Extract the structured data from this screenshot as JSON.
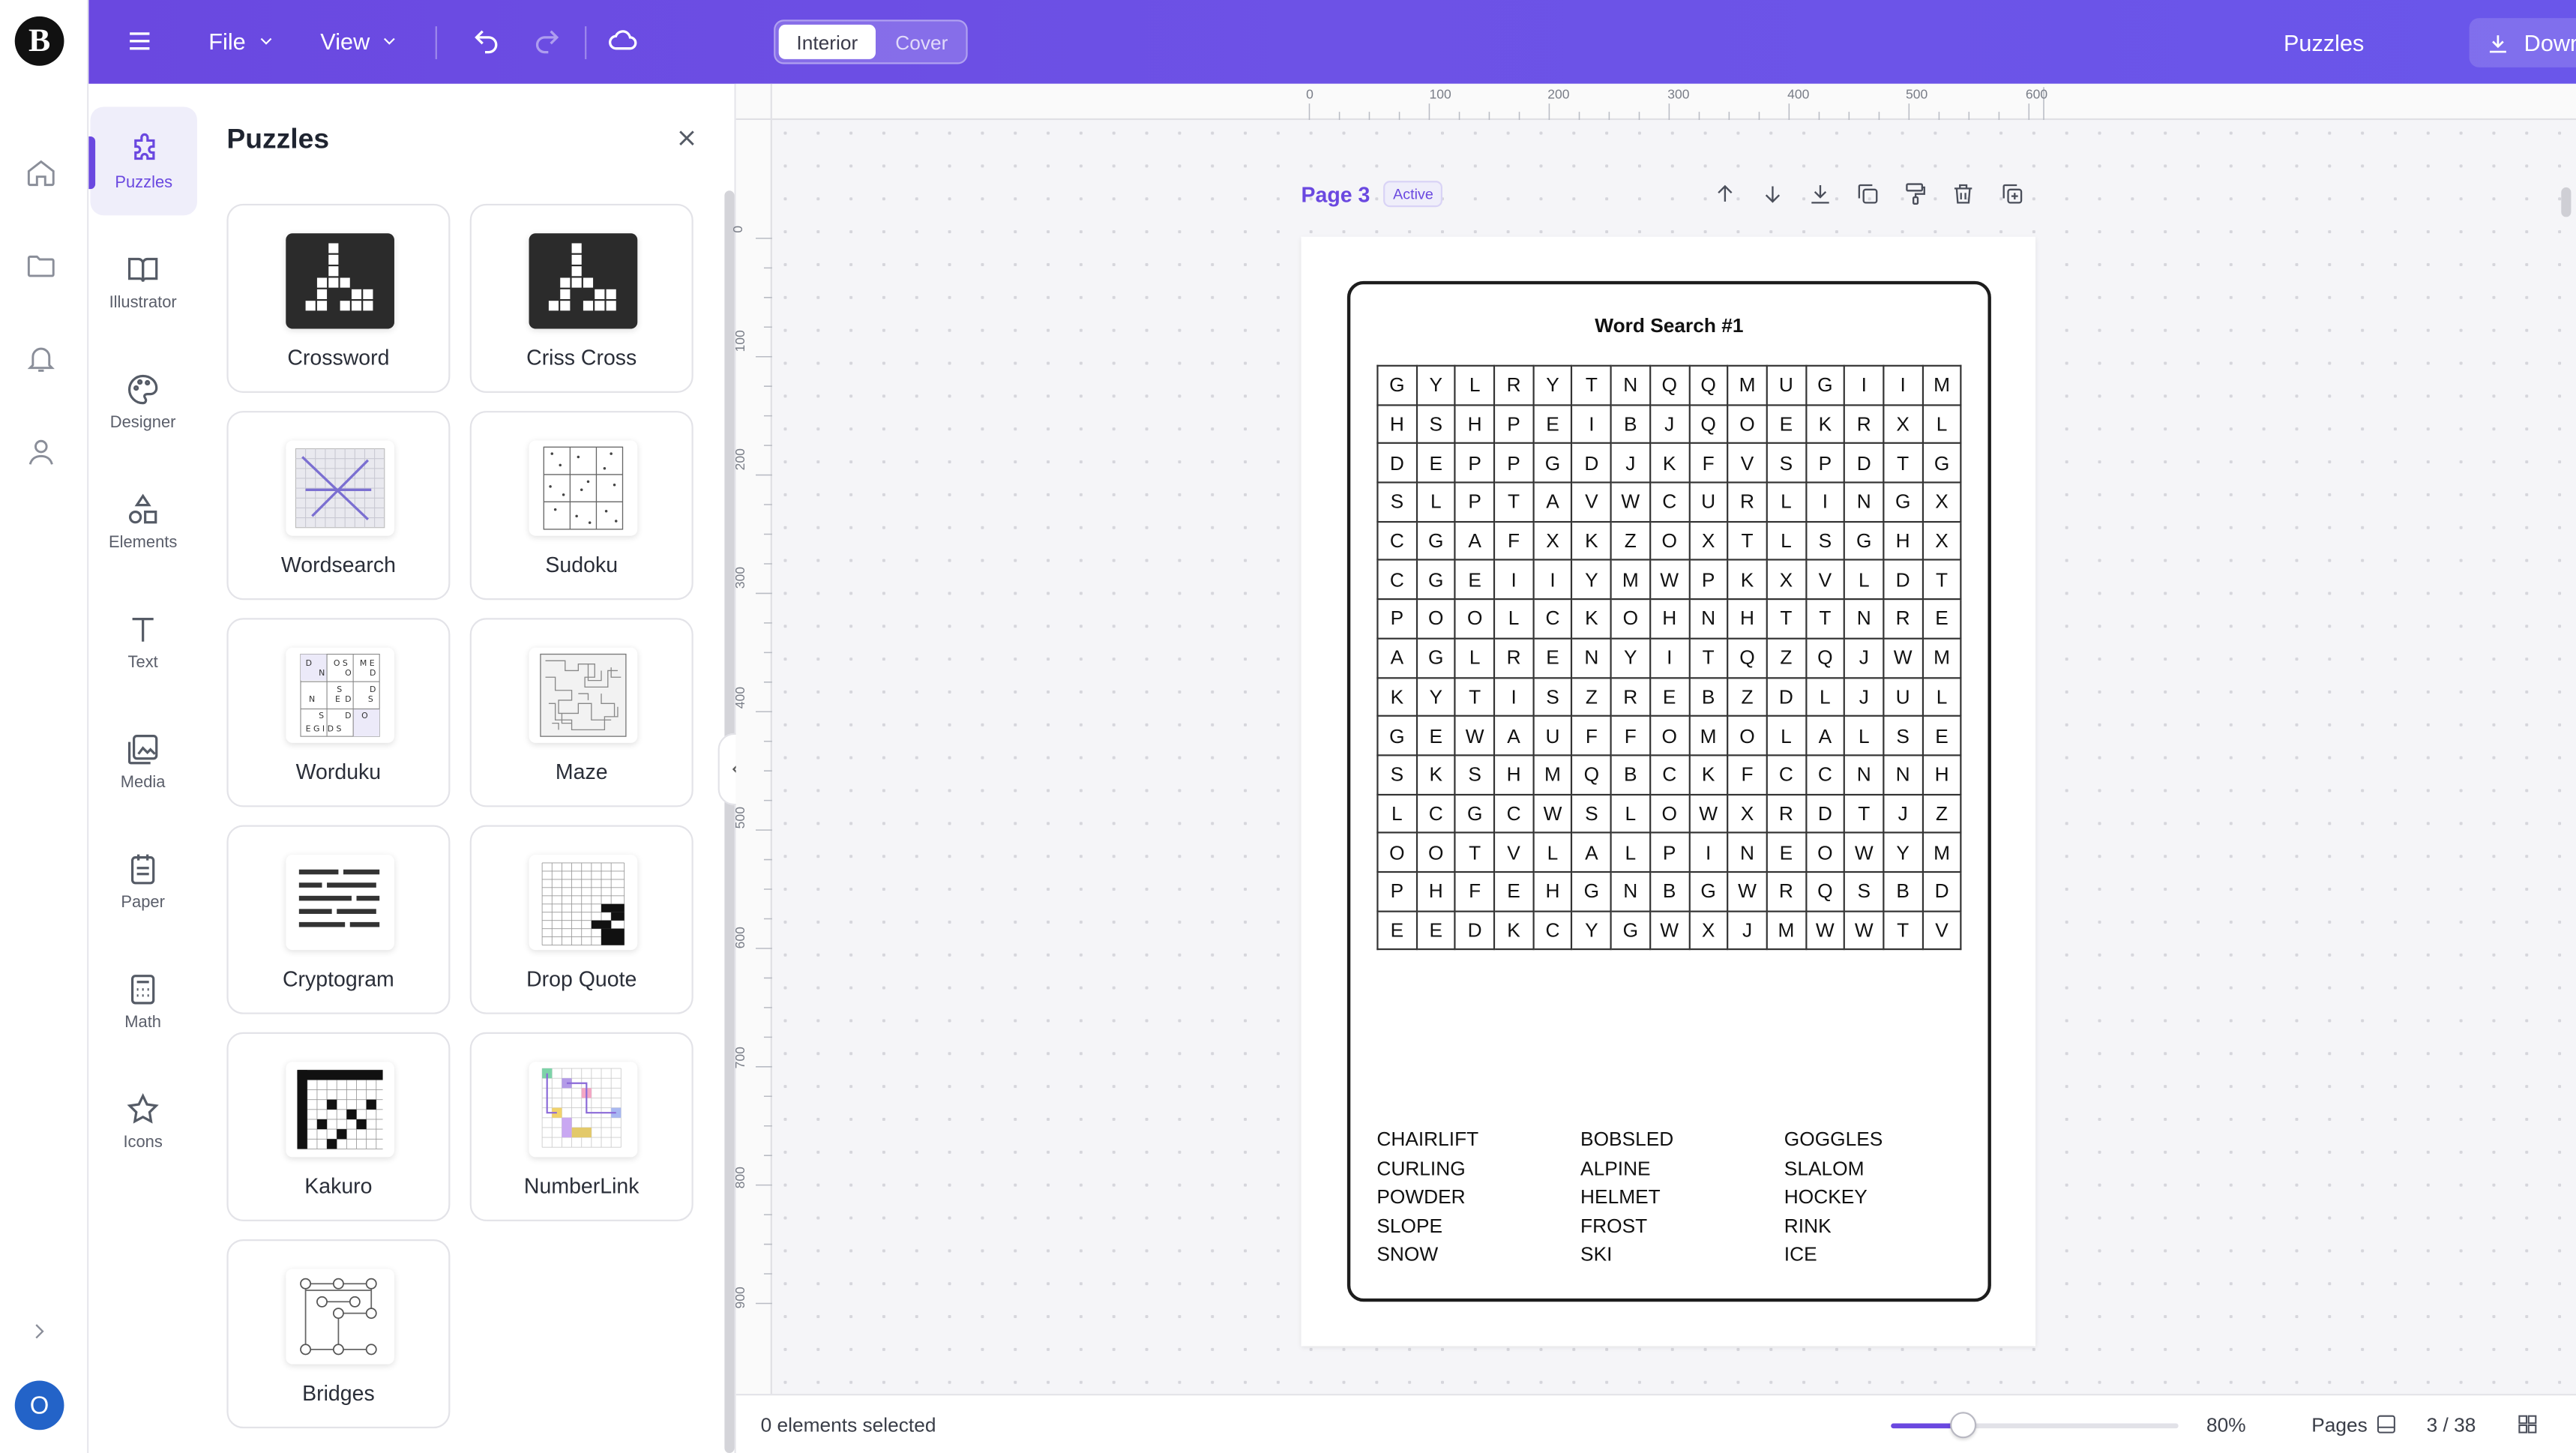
{
  "app": {
    "logo_letter": "B"
  },
  "topbar": {
    "menus": [
      {
        "label": "File"
      },
      {
        "label": "View"
      }
    ],
    "mode_tabs": [
      {
        "label": "Interior",
        "active": true
      },
      {
        "label": "Cover",
        "active": false
      }
    ],
    "puzzles_link": "Puzzles",
    "download_label": "Download"
  },
  "tools": [
    {
      "label": "Puzzles",
      "icon": "puzzle-icon",
      "active": true
    },
    {
      "label": "Illustrator",
      "icon": "book-icon"
    },
    {
      "label": "Designer",
      "icon": "palette-icon"
    },
    {
      "label": "Elements",
      "icon": "shapes-icon"
    },
    {
      "label": "Text",
      "icon": "text-icon"
    },
    {
      "label": "Media",
      "icon": "image-icon"
    },
    {
      "label": "Paper",
      "icon": "paper-icon"
    },
    {
      "label": "Math",
      "icon": "calculator-icon"
    },
    {
      "label": "Icons",
      "icon": "star-icon"
    }
  ],
  "user": {
    "initial": "O"
  },
  "panel": {
    "title": "Puzzles",
    "items": [
      {
        "label": "Crossword"
      },
      {
        "label": "Criss Cross"
      },
      {
        "label": "Wordsearch"
      },
      {
        "label": "Sudoku"
      },
      {
        "label": "Worduku"
      },
      {
        "label": "Maze"
      },
      {
        "label": "Cryptogram"
      },
      {
        "label": "Drop Quote"
      },
      {
        "label": "Kakuro"
      },
      {
        "label": "NumberLink"
      },
      {
        "label": "Bridges"
      }
    ]
  },
  "ruler": {
    "top": [
      "0",
      "100",
      "200",
      "300",
      "400",
      "500",
      "600"
    ],
    "left": [
      "0",
      "100",
      "200",
      "300",
      "400",
      "500",
      "600",
      "700",
      "800",
      "900"
    ]
  },
  "page": {
    "name": "Page 3",
    "badge": "Active",
    "puzzle_title": "Word Search #1",
    "grid": [
      "GYLRYTNQQMUGIIM",
      "HSHPEIBJQOEKRXL",
      "DEPPGDJKFVSPDTG",
      "SLPTAVWCURLINGX",
      "CGAFXKZOXTLSGHX",
      "CGEIIYMWPKXVLDT",
      "POOLCKOHNHTTNRE",
      "AGLRENYITQZQJWM",
      "KYTISZREBZDLJUL",
      "GEWAUFFOMOLALSE",
      "SKSHMQBCKFCCNNH",
      "LCGCWSLOWXRDTJZ",
      "OOTVLALPINEOWYM",
      "PHFEHGNBGWRQSBD",
      "EEDKCYGWXJMWWTV"
    ],
    "word_list": [
      "CHAIRLIFT",
      "BOBSLED",
      "GOGGLES",
      "CURLING",
      "ALPINE",
      "SLALOM",
      "POWDER",
      "HELMET",
      "HOCKEY",
      "SLOPE",
      "FROST",
      "RINK",
      "SNOW",
      "SKI",
      "ICE"
    ]
  },
  "status": {
    "selection": "0 elements selected",
    "zoom": "80%",
    "zoom_level": 0.25,
    "pages_label": "Pages",
    "page_counter": "3 / 38"
  },
  "colors": {
    "accent": "#6a48e0",
    "topbar": "#6b50e6"
  }
}
